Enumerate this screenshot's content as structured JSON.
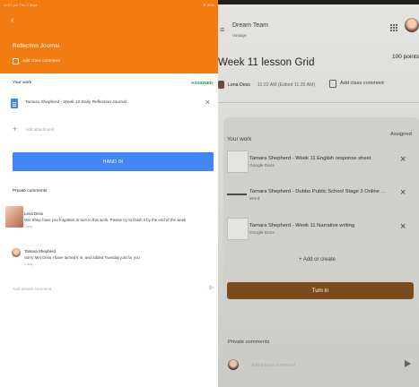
{
  "left": {
    "status": {
      "time": "11:47 pm  Thu 3 Sept",
      "battery": "▼ 46%"
    },
    "back_icon": "‹",
    "assignment_title": "Reflection Journal",
    "add_class_comment": "Add class comment",
    "your_work": {
      "label": "Your work",
      "status": "ASSIGNED"
    },
    "attachment": {
      "name": "Tamara Shepherd - Week 10 Daily Reflection Journal",
      "remove": "×"
    },
    "add_attachment": {
      "plus": "+",
      "label": "Add attachment"
    },
    "hand_in": "HAND IN",
    "private_comments_title": "Private comments",
    "comments": [
      {
        "author": "Lena Dess",
        "text": "Mrs Shep have you forgotten to turn in this work. Please try to finish it by the end of the week",
        "time": "1 day"
      },
      {
        "author": "Tamara Shepherd",
        "text": "Sorry Mrs Dess I have turned it in, and added Tuesday just for you",
        "time": "1 day"
      }
    ],
    "private_comment_placeholder": "Add private comment"
  },
  "right": {
    "menu_icon": "≡",
    "class_name": "Dream Team",
    "class_sub": "Vintage",
    "lesson_title": "Week 11 lesson Grid",
    "points": "100 points",
    "author": "Lena Dess",
    "post_time": "11:22 AM (Edited 11:25 AM)",
    "add_class_comment": "Add class comment",
    "your_work": "Your work",
    "status": "Assigned",
    "attachments": [
      {
        "title": "Tamara Shepherd - Week 11 English response sheet",
        "type": "Google Docs",
        "remove": "×"
      },
      {
        "title": "Tamara Shepherd - Dubbo Public School Stage 3 Online ...",
        "type": "Word",
        "remove": "×"
      },
      {
        "title": "Tamara Shepherd - Week 11 Narrative writing",
        "type": "Google Docs",
        "remove": "×"
      }
    ],
    "add_or_create": "+ Add or create",
    "turn_in": "Turn in",
    "private_comments": "Private comments",
    "private_comment_placeholder": "Add private comment"
  },
  "colors": {
    "header_orange": "#f07c12",
    "hand_in_blue": "#4285f4",
    "assigned_green": "#1e8e3e",
    "turn_in_brown": "#7a4b1c"
  }
}
